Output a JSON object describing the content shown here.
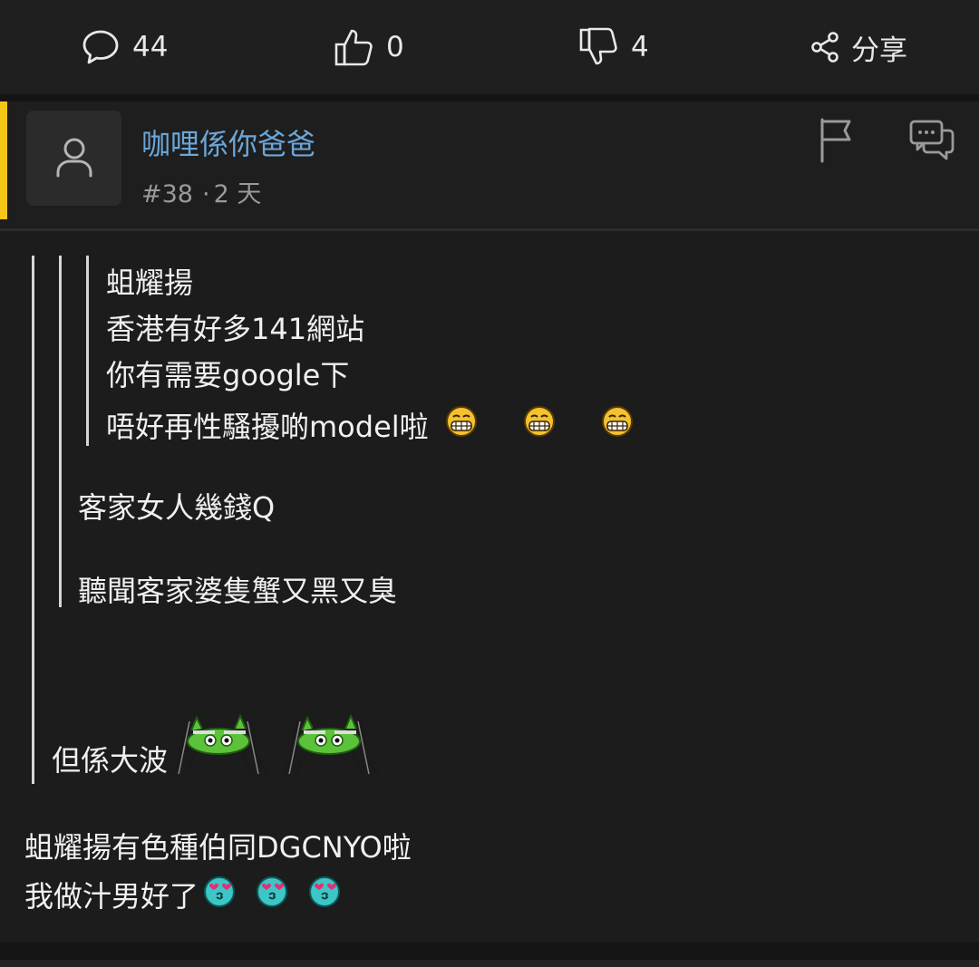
{
  "toolbar": {
    "comments": "44",
    "likes": "0",
    "dislikes": "4",
    "share": "分享"
  },
  "post": {
    "username": "咖哩係你爸爸",
    "number": "#38",
    "time": "2 天",
    "quote_level3": [
      "蛆耀揚",
      "香港有好多141網站",
      "你有需要google下",
      "唔好再性騷擾啲model啦"
    ],
    "quote_level2": [
      "客家女人幾錢Q",
      "聽聞客家婆隻蟹又黑又臭"
    ],
    "quote_level1": "但係大波",
    "body": [
      "蛆耀揚有色種伯同DGCNYO啦",
      "我做汁男好了"
    ]
  },
  "colors": {
    "accent": "#f5c518",
    "username": "#6ba6d8"
  },
  "icons": {
    "comment": "comment-icon",
    "like": "thumbs-up-icon",
    "dislike": "thumbs-down-icon",
    "share": "share-icon",
    "flag": "flag-icon",
    "reply": "reply-icon",
    "avatar": "user-icon"
  }
}
